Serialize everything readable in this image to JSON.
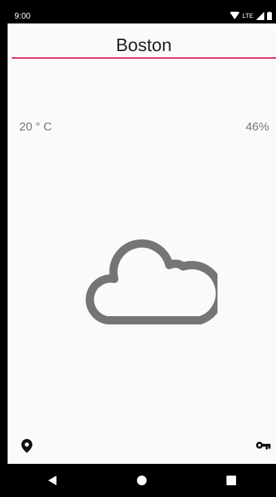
{
  "status_bar": {
    "time": "9:00",
    "network": "LTE",
    "icons": [
      "wifi-icon",
      "signal-icon",
      "battery-icon"
    ]
  },
  "header": {
    "city": "Boston",
    "accent_color": "#d81b60"
  },
  "weather": {
    "temperature": "20 ° C",
    "humidity": "46%",
    "condition_icon": "cloud-icon"
  },
  "footer": {
    "left_icon": "location-pin-icon",
    "right_icon": "key-icon"
  },
  "nav_bar": {
    "buttons": [
      "back-button",
      "home-button",
      "recents-button"
    ]
  }
}
